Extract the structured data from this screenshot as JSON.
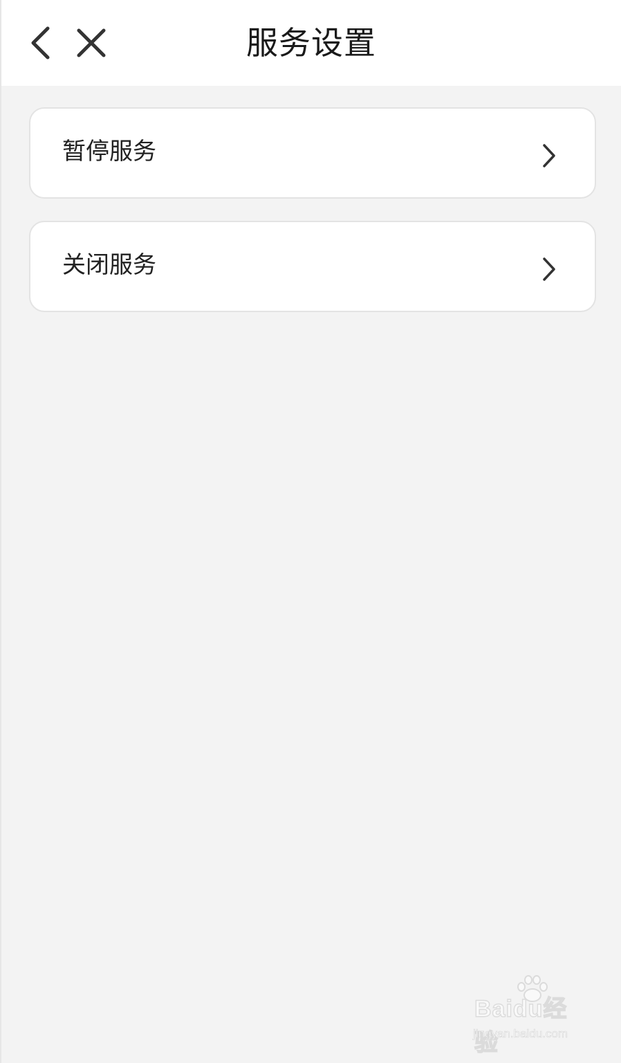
{
  "header": {
    "title": "服务设置"
  },
  "menu": {
    "items": [
      {
        "label": "暂停服务"
      },
      {
        "label": "关闭服务"
      }
    ]
  },
  "watermark": {
    "brand": "Baidu经验",
    "url": "jingyan.baidu.com"
  },
  "colors": {
    "background": "#f3f3f3",
    "card": "#ffffff",
    "text": "#222222",
    "border": "#e3e3e3"
  },
  "icons": [
    "back-arrow-icon",
    "close-icon",
    "chevron-right-icon"
  ]
}
